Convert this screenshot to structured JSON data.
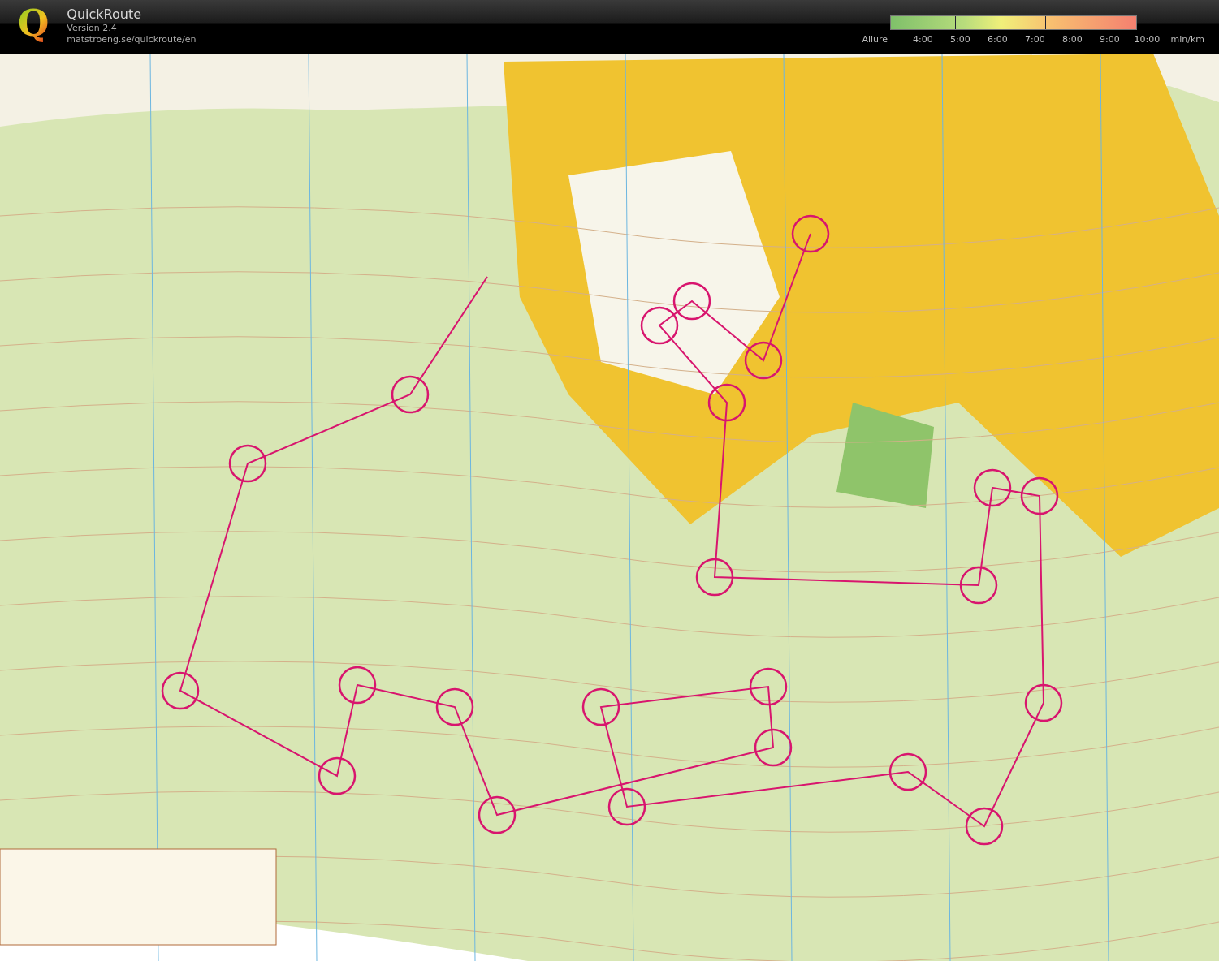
{
  "app": {
    "logo_letter": "Q",
    "title": "QuickRoute",
    "version": "Version 2.4",
    "url": "matstroeng.se/quickroute/en"
  },
  "pace_legend": {
    "label": "Allure",
    "ticks": [
      "4:00",
      "5:00",
      "6:00",
      "7:00",
      "8:00",
      "9:00",
      "10:00"
    ],
    "unit": "min/km"
  }
}
